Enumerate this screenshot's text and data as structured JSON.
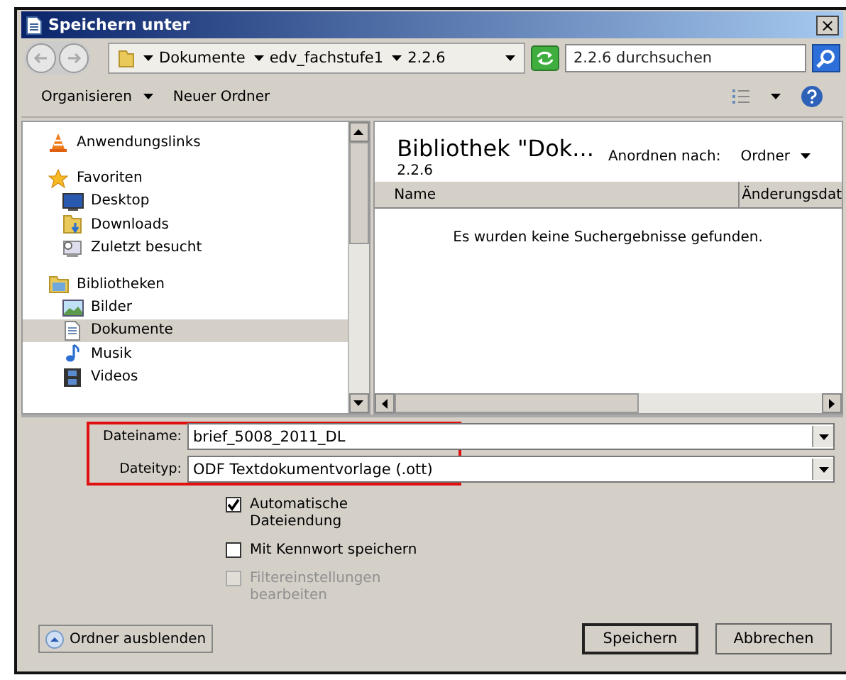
{
  "window": {
    "title": "Speichern unter",
    "close": "×"
  },
  "address": {
    "segments": [
      "Dokumente",
      "edv_fachstufe1",
      "2.2.6"
    ],
    "search_placeholder": "2.2.6 durchsuchen"
  },
  "toolbar": {
    "organize": "Organisieren",
    "new_folder": "Neuer Ordner"
  },
  "nav": [
    {
      "kind": "group",
      "label": "Anwendungslinks",
      "selected": false
    },
    {
      "kind": "group",
      "label": "Favoriten",
      "selected": false
    },
    {
      "kind": "item",
      "label": "Desktop",
      "selected": false
    },
    {
      "kind": "item",
      "label": "Downloads",
      "selected": false
    },
    {
      "kind": "item",
      "label": "Zuletzt besucht",
      "selected": false
    },
    {
      "kind": "group",
      "label": "Bibliotheken",
      "selected": false
    },
    {
      "kind": "item",
      "label": "Bilder",
      "selected": false
    },
    {
      "kind": "item",
      "label": "Dokumente",
      "selected": true
    },
    {
      "kind": "item",
      "label": "Musik",
      "selected": false
    },
    {
      "kind": "item",
      "label": "Videos",
      "selected": false
    }
  ],
  "library": {
    "title": "Bibliothek \"Dok...",
    "subtitle": "2.2.6",
    "arrange_label": "Anordnen nach:",
    "arrange_value": "Ordner"
  },
  "table": {
    "columns": [
      "Name",
      "Änderungsdat"
    ],
    "empty_message": "Es wurden keine Suchergebnisse gefunden."
  },
  "form": [
    {
      "label": "Dateiname:",
      "value": "brief_5008_2011_DL"
    },
    {
      "label": "Dateityp:",
      "value": "ODF Textdokumentvorlage (.ott)"
    }
  ],
  "options": [
    {
      "label": "Automatische Dateiendung",
      "checked": true,
      "disabled": false
    },
    {
      "label": "Mit Kennwort speichern",
      "checked": false,
      "disabled": false
    },
    {
      "label": "Filtereinstellungen bearbeiten",
      "checked": false,
      "disabled": true
    }
  ],
  "hide_folders": "Ordner ausblenden",
  "buttons": [
    "Speichern",
    "Abbrechen"
  ]
}
